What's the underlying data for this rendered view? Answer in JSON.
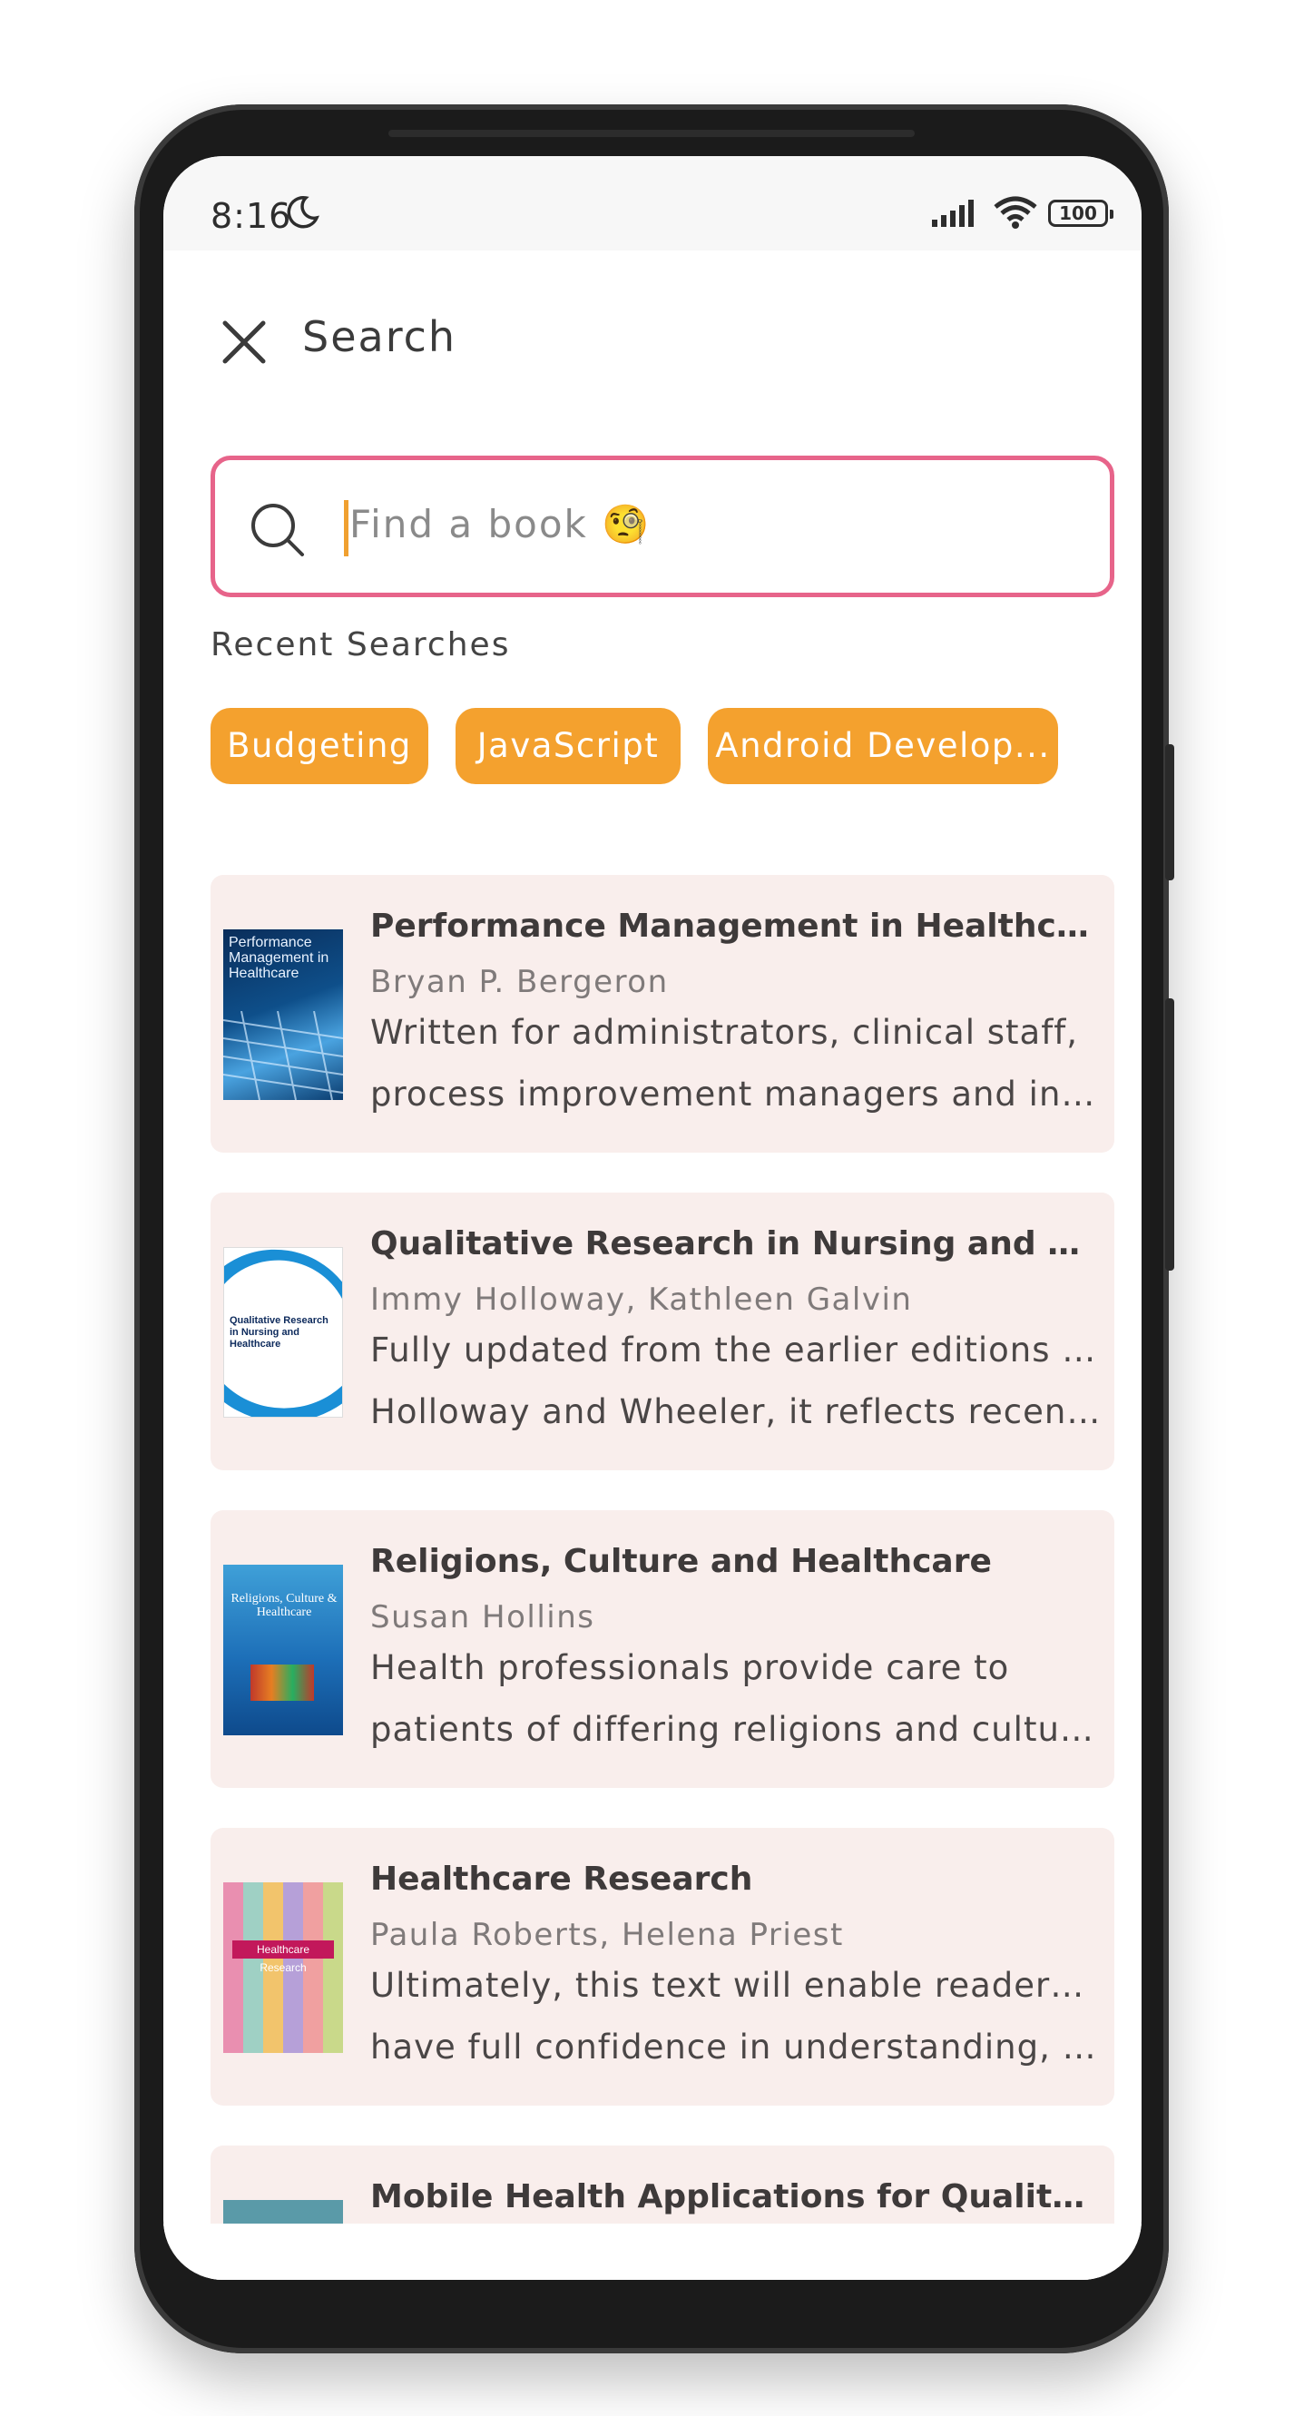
{
  "status_bar": {
    "time": "8:16",
    "battery": "100",
    "icons": [
      "moon-icon",
      "signal-icon",
      "wifi-icon",
      "battery-icon"
    ]
  },
  "header": {
    "title": "Search",
    "close_icon": "close-icon"
  },
  "search": {
    "placeholder": "Find a book 🧐",
    "icon": "search-icon",
    "border_color": "#e7648a"
  },
  "recent": {
    "label": "Recent Searches",
    "chips": [
      "Budgeting",
      "JavaScript",
      "Android Develop..."
    ],
    "chip_color": "#f4a12e"
  },
  "books": [
    {
      "title": "Performance Management in Healthcare",
      "author": "Bryan P. Bergeron",
      "desc_line1": "Written for administrators, clinical staff,",
      "desc_line2": "process improvement managers and information technology professionals",
      "cover_text": "Performance Management in Healthcare"
    },
    {
      "title": "Qualitative Research in Nursing and Healthcare",
      "author": "Immy Holloway, Kathleen Galvin",
      "desc_line1": "Fully updated from the earlier editions by",
      "desc_line2": "Holloway and Wheeler, it reflects recent developments",
      "cover_text": "Qualitative Research in Nursing and Healthcare"
    },
    {
      "title": "Religions, Culture and Healthcare",
      "author": "Susan Hollins",
      "desc_line1": "Health professionals provide care to",
      "desc_line2": "patients of differing religions and cultures",
      "cover_text": "Religions, Culture & Healthcare"
    },
    {
      "title": "Healthcare Research",
      "author": "Paula Roberts, Helena Priest",
      "desc_line1": "Ultimately, this text will enable readers to",
      "desc_line2": "have full confidence in understanding, using research",
      "cover_text": "Healthcare Research"
    },
    {
      "title": "Mobile Health Applications for Quality Healthcare Delivery",
      "author": "",
      "desc_line1": "",
      "desc_line2": "",
      "cover_text": ""
    }
  ]
}
